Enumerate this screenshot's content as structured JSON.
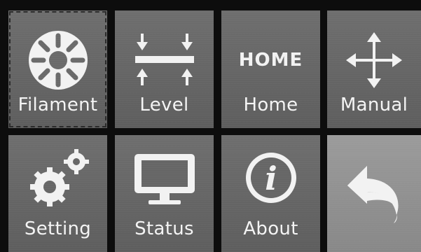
{
  "menu": {
    "tiles": [
      {
        "label": "Filament",
        "icon": "filament-gear-icon"
      },
      {
        "label": "Level",
        "icon": "level-arrows-icon"
      },
      {
        "label": "Home",
        "icon": "home-text-icon",
        "icon_text": "HOME"
      },
      {
        "label": "Manual",
        "icon": "move-arrows-icon"
      },
      {
        "label": "Setting",
        "icon": "settings-gears-icon"
      },
      {
        "label": "Status",
        "icon": "monitor-icon"
      },
      {
        "label": "About",
        "icon": "info-icon",
        "icon_text": "i"
      },
      {
        "label": "",
        "icon": "back-arrow-icon"
      }
    ]
  },
  "colors": {
    "tile": "#676767",
    "tile_back": "#909090",
    "grid_gap": "#0d0d0d",
    "text": "#f2f2f2"
  }
}
